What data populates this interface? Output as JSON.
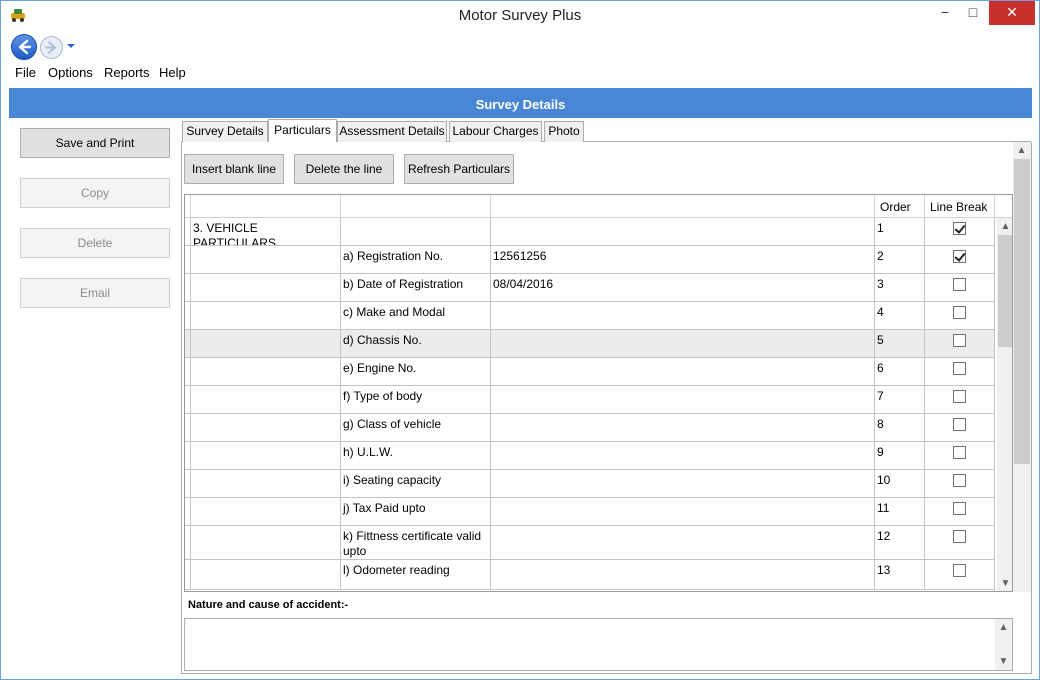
{
  "window": {
    "title": "Motor Survey Plus",
    "min": "−",
    "max": "□",
    "close": "✕"
  },
  "nav": {
    "back_glyph": "←",
    "forward_glyph": "→",
    "dropdown_glyph": "▾"
  },
  "menu": [
    "File",
    "Options",
    "Reports",
    "Help"
  ],
  "header": {
    "title": "Survey Details"
  },
  "sidebar": {
    "save_print": "Save and Print",
    "copy": "Copy",
    "delete": "Delete",
    "email": "Email"
  },
  "tabs": [
    "Survey Details",
    "Particulars",
    "Assessment Details",
    "Labour Charges",
    "Photo"
  ],
  "toolbar": {
    "insert": "Insert blank line",
    "delete_line": "Delete the line",
    "refresh": "Refresh Particulars"
  },
  "grid": {
    "headers": [
      "",
      "",
      "",
      "Order",
      "Line Break"
    ],
    "rows": [
      {
        "c1": "3. VEHICLE PARTICULARS",
        "c2": "",
        "c3": "",
        "order": "1",
        "line_break": true
      },
      {
        "c1": "",
        "c2": "a) Registration No.",
        "c3": "12561256",
        "order": "2",
        "line_break": true
      },
      {
        "c1": "",
        "c2": "b) Date of Registration",
        "c3": "08/04/2016",
        "order": "3",
        "line_break": false
      },
      {
        "c1": "",
        "c2": "c) Make and Modal",
        "c3": "",
        "order": "4",
        "line_break": false
      },
      {
        "c1": "",
        "c2": "d) Chassis No.",
        "c3": "",
        "order": "5",
        "line_break": false
      },
      {
        "c1": "",
        "c2": "e) Engine No.",
        "c3": "",
        "order": "6",
        "line_break": false
      },
      {
        "c1": "",
        "c2": "f) Type of body",
        "c3": "",
        "order": "7",
        "line_break": false
      },
      {
        "c1": "",
        "c2": "g) Class of vehicle",
        "c3": "",
        "order": "8",
        "line_break": false
      },
      {
        "c1": "",
        "c2": "h) U.L.W.",
        "c3": "",
        "order": "9",
        "line_break": false
      },
      {
        "c1": "",
        "c2": "i) Seating capacity",
        "c3": "",
        "order": "10",
        "line_break": false
      },
      {
        "c1": "",
        "c2": "j) Tax Paid upto",
        "c3": "",
        "order": "11",
        "line_break": false
      },
      {
        "c1": "",
        "c2": "k) Fittness certificate valid upto",
        "c3": "",
        "order": "12",
        "line_break": false
      },
      {
        "c1": "",
        "c2": "l) Odometer reading",
        "c3": "",
        "order": "13",
        "line_break": false
      }
    ]
  },
  "accident": {
    "label": "Nature and cause of accident:-",
    "value": ""
  },
  "colors": {
    "accent": "#4a86d6",
    "close": "#c7302b"
  }
}
